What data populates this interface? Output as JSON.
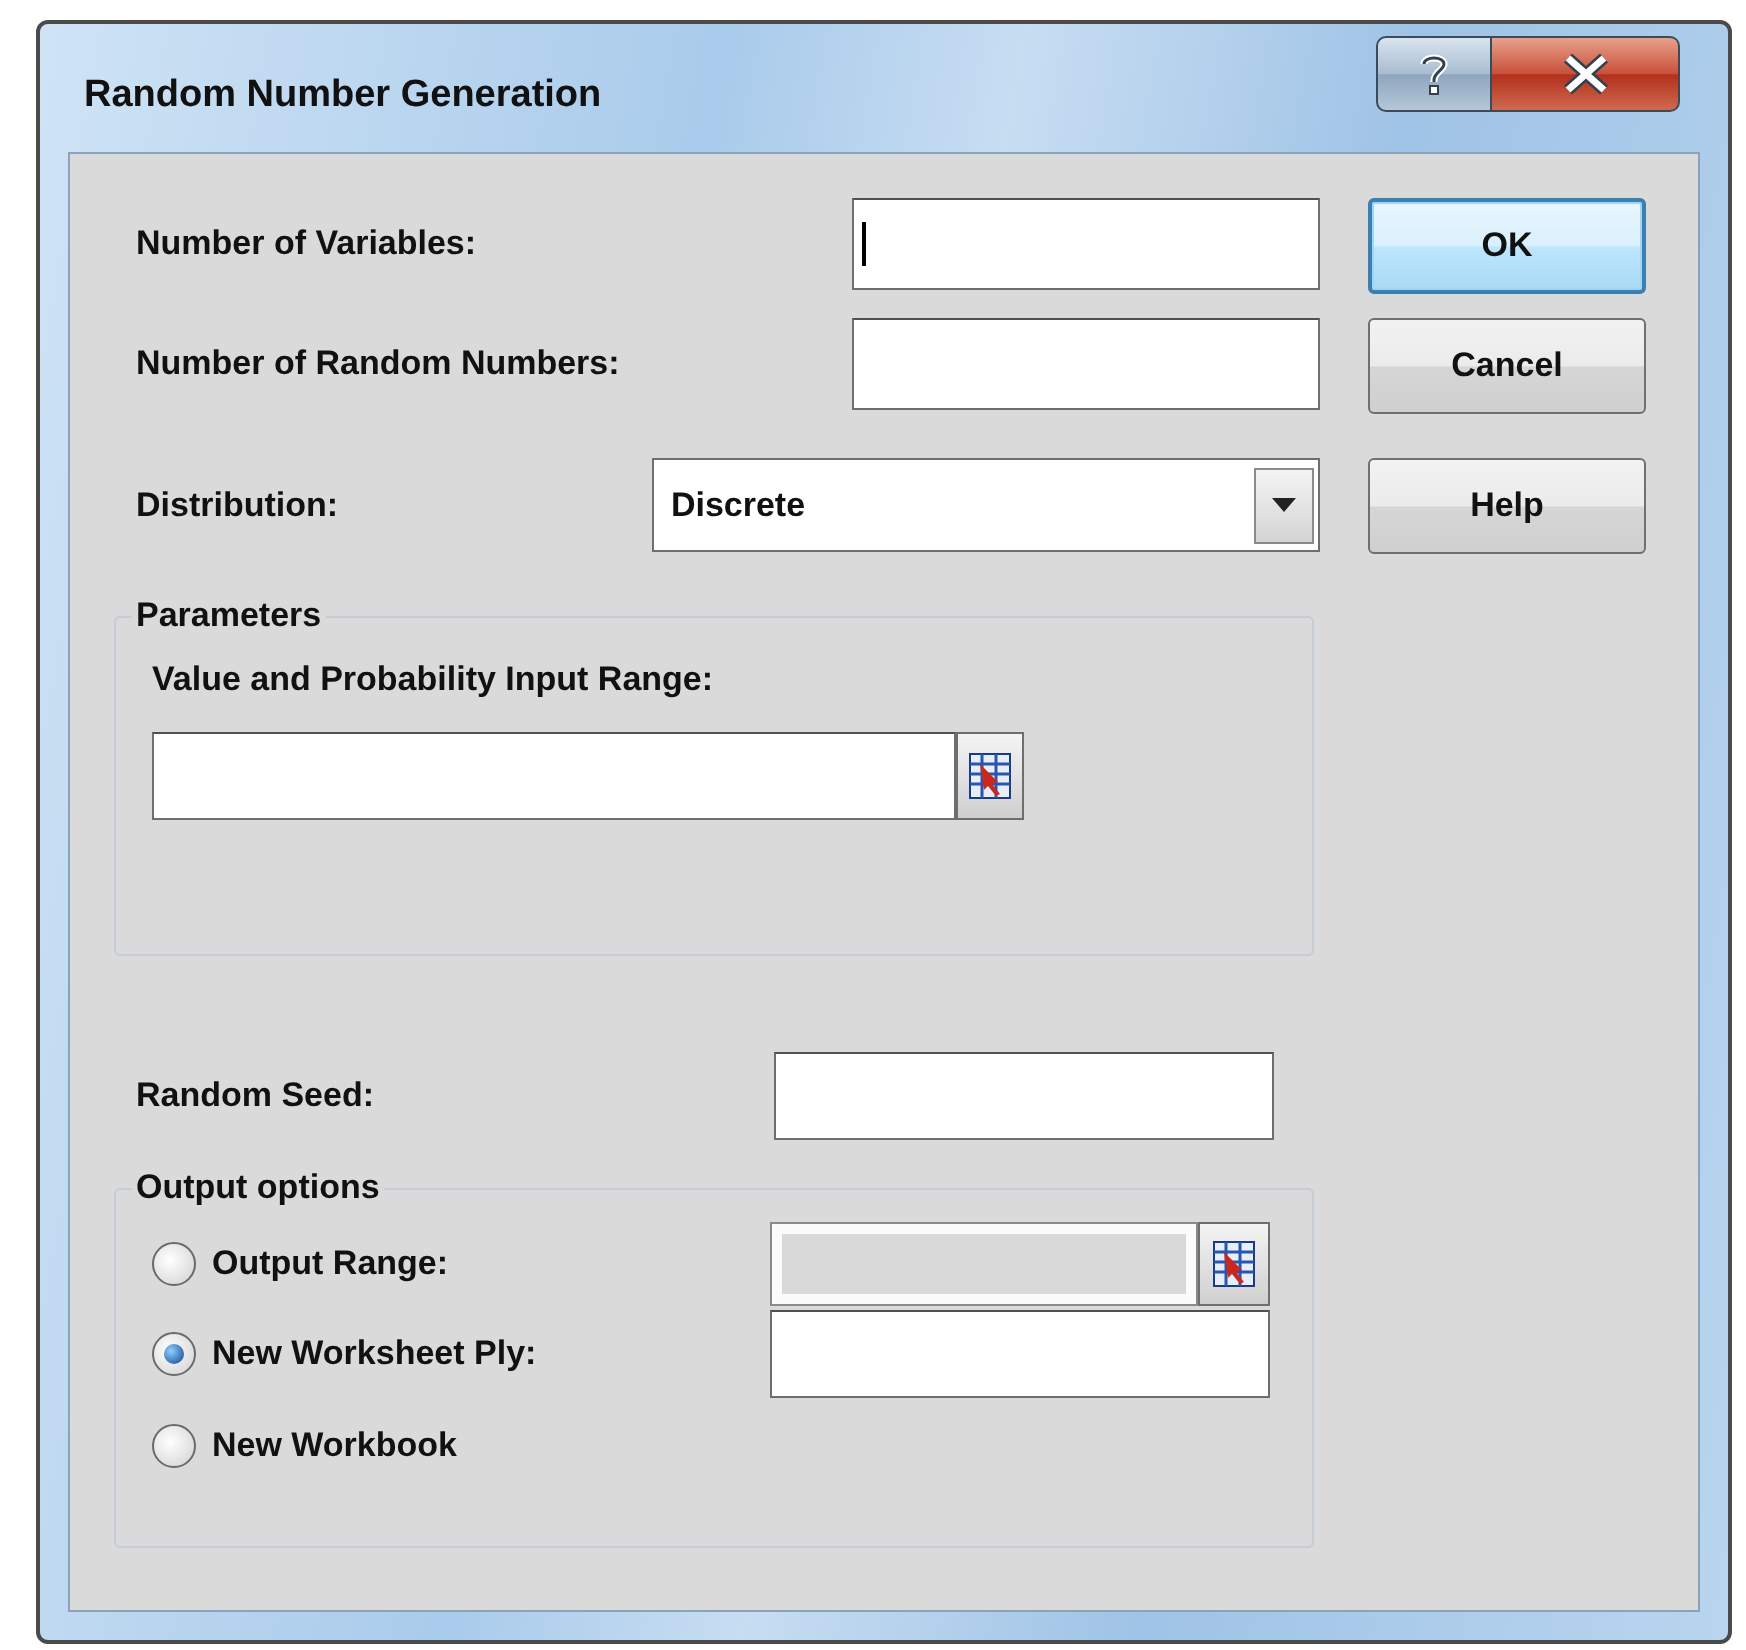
{
  "window": {
    "title": "Random Number Generation"
  },
  "fields": [
    {
      "label": "Number of Variables:",
      "focused": true
    },
    {
      "label": "Number of Random Numbers:",
      "focused": false
    }
  ],
  "distribution": {
    "label": "Distribution:",
    "value": "Discrete"
  },
  "parameters": {
    "title": "Parameters",
    "label": "Value and Probability Input Range:"
  },
  "random_seed": {
    "label": "Random Seed:"
  },
  "output_options": {
    "title": "Output options",
    "options": [
      {
        "label": "Output Range:",
        "selected": false,
        "kind": "range",
        "disabled": true
      },
      {
        "label": "New Worksheet Ply:",
        "selected": true,
        "kind": "text",
        "disabled": false
      },
      {
        "label": "New Workbook",
        "selected": false,
        "kind": "none"
      }
    ]
  },
  "buttons": [
    {
      "label": "OK",
      "default": true
    },
    {
      "label": "Cancel",
      "default": false
    },
    {
      "label": "Help",
      "default": false
    }
  ]
}
